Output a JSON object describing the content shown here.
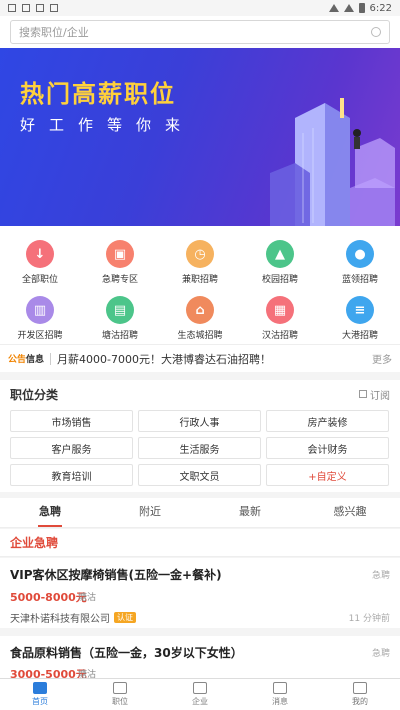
{
  "status_bar": {
    "time": "6:22"
  },
  "search": {
    "placeholder": "搜索职位/企业"
  },
  "banner": {
    "title": "热门高薪职位",
    "subtitle": "好工作等你来"
  },
  "categories": [
    {
      "label": "全部职位",
      "icon": "download-icon",
      "color": "#f5717a"
    },
    {
      "label": "急聘专区",
      "icon": "bag-icon",
      "color": "#f7816e"
    },
    {
      "label": "兼职招聘",
      "icon": "clock-icon",
      "color": "#f6b25f"
    },
    {
      "label": "校园招聘",
      "icon": "graduation-cap-icon",
      "color": "#4cc58a"
    },
    {
      "label": "蓝领招聘",
      "icon": "person-icon",
      "color": "#3fa6ee"
    },
    {
      "label": "开发区招聘",
      "icon": "building-icon",
      "color": "#a98ae8"
    },
    {
      "label": "塘沽招聘",
      "icon": "document-icon",
      "color": "#4cc58a"
    },
    {
      "label": "生态城招聘",
      "icon": "landmark-icon",
      "color": "#f08a5d"
    },
    {
      "label": "汉沽招聘",
      "icon": "buildings-icon",
      "color": "#f5717a"
    },
    {
      "label": "大港招聘",
      "icon": "doc-list-icon",
      "color": "#3fa6ee"
    }
  ],
  "notice": {
    "tag_a": "公告",
    "tag_b": "信息",
    "text": "月薪4000-7000元！大港博睿达石油招聘！",
    "more": "更多"
  },
  "job_categories": {
    "title": "职位分类",
    "subscribe": "订阅",
    "tags": [
      "市场销售",
      "行政人事",
      "房产装修",
      "客户服务",
      "生活服务",
      "会计财务",
      "教育培训",
      "文职文员",
      "+自定义"
    ]
  },
  "tabs": [
    "急聘",
    "附近",
    "最新",
    "感兴趣"
  ],
  "urgent_header": "企业急聘",
  "jobs": [
    {
      "title": "VIP客休区按摩椅销售(五险一金+餐补)",
      "badge": "急聘",
      "salary": "5000-8000元",
      "location": "塘沽",
      "company": "天津朴诺科技有限公司",
      "verified": "认证",
      "time": "11 分钟前"
    },
    {
      "title": "食品原料销售（五险一金，30岁以下女性）",
      "badge": "急聘",
      "salary": "3000-5000元",
      "location": "塘沽"
    }
  ],
  "bottom_nav": [
    "首页",
    "职位",
    "企业",
    "消息",
    "我的"
  ]
}
